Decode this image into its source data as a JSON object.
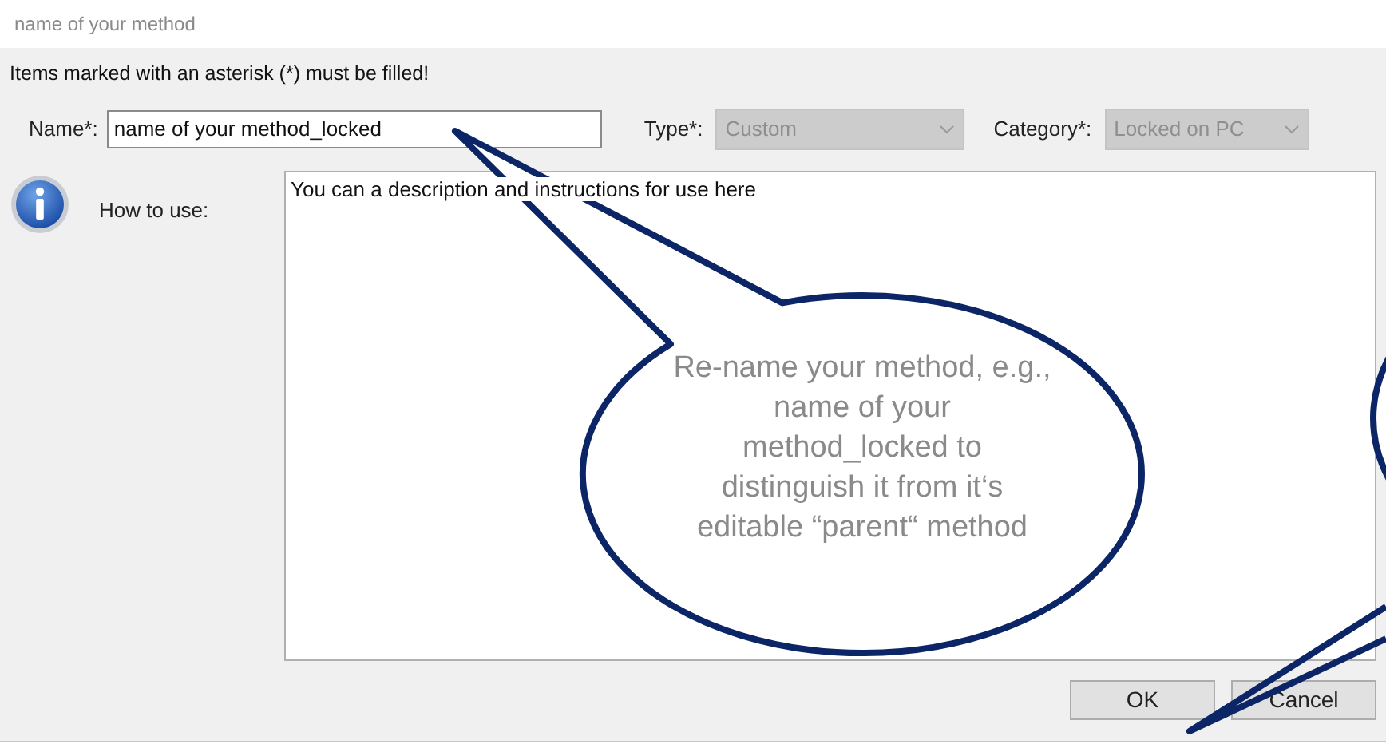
{
  "window": {
    "title": "name of your method"
  },
  "notice": "Items marked with an asterisk (*) must be filled!",
  "fields": [
    {
      "kind": "text",
      "label": "Name*:",
      "value": "name of your method_locked",
      "disabled": false
    },
    {
      "kind": "select",
      "label": "Type*:",
      "value": "Custom",
      "disabled": true
    },
    {
      "kind": "select",
      "label": "Category*:",
      "value": "Locked on PC",
      "disabled": true
    }
  ],
  "how_to_use": {
    "label": "How to use:",
    "value": "You can a description and instructions for use here"
  },
  "buttons": [
    {
      "label": "OK"
    },
    {
      "label": "Cancel"
    }
  ],
  "callout": {
    "text": "Re-name your method, e.g., name of your method_locked to distinguish it from it‘s editable “parent“ method"
  }
}
